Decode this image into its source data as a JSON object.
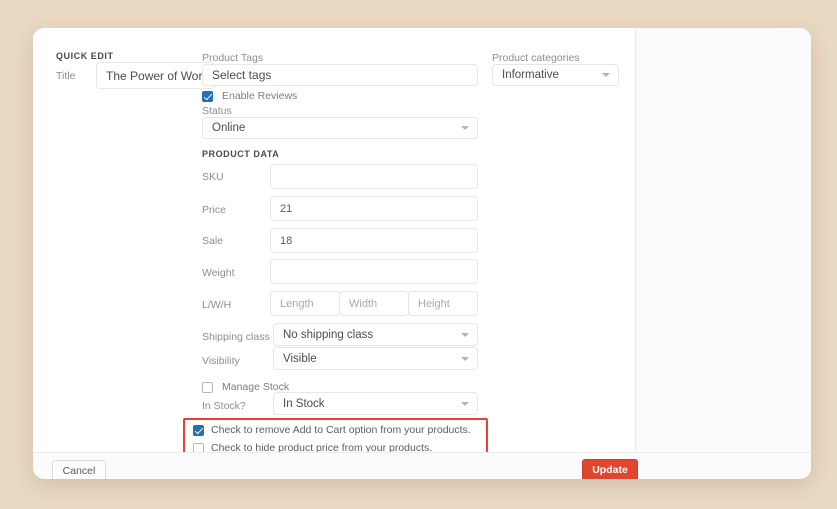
{
  "page": {
    "background_color": "#ead9c3",
    "panel_color": "#ffffff",
    "accent_color": "#e0452d",
    "checkbox_color": "#2271b1",
    "alert_border_color": "#ef3d2e"
  },
  "sections": {
    "quick_edit_heading": "QUICK EDIT",
    "product_data_heading": "PRODUCT DATA"
  },
  "left_column": {
    "title_label": "Title",
    "title_value": "The Power of Wor"
  },
  "middle_column": {
    "product_tags_label": "Product Tags",
    "product_tags_placeholder": "Select tags",
    "enable_reviews_label": "Enable Reviews",
    "enable_reviews_checked": true,
    "status_label": "Status",
    "status_value": "Online"
  },
  "right_column": {
    "product_categories_label": "Product categories",
    "product_categories_value": "Informative"
  },
  "product_data": {
    "sku_label": "SKU",
    "sku_value": "",
    "price_label": "Price",
    "price_value": "21",
    "sale_label": "Sale",
    "sale_value": "18",
    "weight_label": "Weight",
    "weight_value": "",
    "lwh_label": "L/W/H",
    "length_placeholder": "Length",
    "width_placeholder": "Width",
    "height_placeholder": "Height",
    "shipping_class_label": "Shipping class",
    "shipping_class_value": "No shipping class",
    "visibility_label": "Visibility",
    "visibility_value": "Visible",
    "manage_stock_label": "Manage Stock",
    "manage_stock_checked": false,
    "in_stock_label": "In Stock?",
    "in_stock_value": "In Stock"
  },
  "highlighted_options": {
    "remove_add_to_cart_label": "Check to remove Add to Cart option from your products.",
    "remove_add_to_cart_checked": true,
    "hide_price_label": "Check to hide product price from your products.",
    "hide_price_checked": false
  },
  "footer": {
    "cancel_label": "Cancel",
    "update_label": "Update"
  }
}
